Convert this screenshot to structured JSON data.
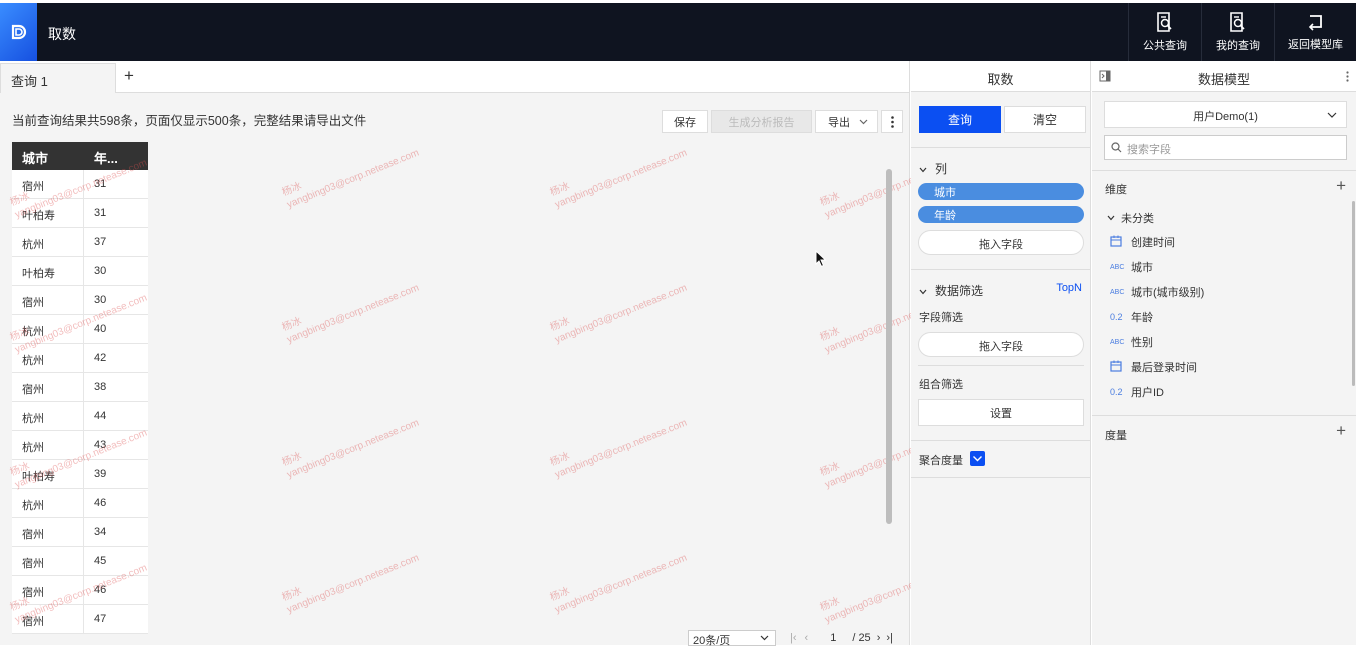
{
  "app": {
    "title": "取数"
  },
  "top_actions": [
    {
      "label": "公共查询",
      "icon": "public-query-icon"
    },
    {
      "label": "我的查询",
      "icon": "my-query-icon"
    },
    {
      "label": "返回模型库",
      "icon": "return-icon"
    }
  ],
  "tabs": {
    "active_label": "查询 1",
    "add_symbol": "+"
  },
  "results": {
    "info": "当前查询结果共598条，页面仅显示500条，完整结果请导出文件",
    "save_label": "保存",
    "report_label": "生成分析报告",
    "export_label": "导出",
    "columns": [
      "城市",
      "年..."
    ],
    "rows": [
      [
        "宿州",
        "31"
      ],
      [
        "叶柏寿",
        "31"
      ],
      [
        "杭州",
        "37"
      ],
      [
        "叶柏寿",
        "30"
      ],
      [
        "宿州",
        "30"
      ],
      [
        "杭州",
        "40"
      ],
      [
        "杭州",
        "42"
      ],
      [
        "宿州",
        "38"
      ],
      [
        "杭州",
        "44"
      ],
      [
        "杭州",
        "43"
      ],
      [
        "叶柏寿",
        "39"
      ],
      [
        "杭州",
        "46"
      ],
      [
        "宿州",
        "34"
      ],
      [
        "宿州",
        "45"
      ],
      [
        "宿州",
        "46"
      ],
      [
        "宿州",
        "47"
      ]
    ]
  },
  "watermark": {
    "name": "杨冰",
    "email": "yangbing03@corp.netease.com"
  },
  "pager": {
    "page_size": "20条/页",
    "current": "1",
    "total": "/ 25"
  },
  "query_panel": {
    "title": "取数",
    "query_label": "查询",
    "clear_label": "清空",
    "columns_title": "列",
    "column_pills": [
      "城市",
      "年龄"
    ],
    "drop_label": "拖入字段",
    "filter_title": "数据筛选",
    "topn_label": "TopN",
    "field_filter_label": "字段筛选",
    "combo_filter_label": "组合筛选",
    "settings_label": "设置",
    "aggregate_label": "聚合度量",
    "accent": "#0b4ff2"
  },
  "model_panel": {
    "title": "数据模型",
    "model_name": "用户Demo(1)",
    "search_placeholder": "搜索字段",
    "dimension_label": "维度",
    "group_label": "未分类",
    "fields": [
      {
        "type": "date",
        "label": "创建时间"
      },
      {
        "type": "ABC",
        "label": "城市"
      },
      {
        "type": "ABC",
        "label": "城市(城市级别)"
      },
      {
        "type": "0.2",
        "label": "年龄"
      },
      {
        "type": "ABC",
        "label": "性别"
      },
      {
        "type": "date",
        "label": "最后登录时间"
      },
      {
        "type": "0.2",
        "label": "用户ID"
      }
    ],
    "measure_label": "度量"
  }
}
